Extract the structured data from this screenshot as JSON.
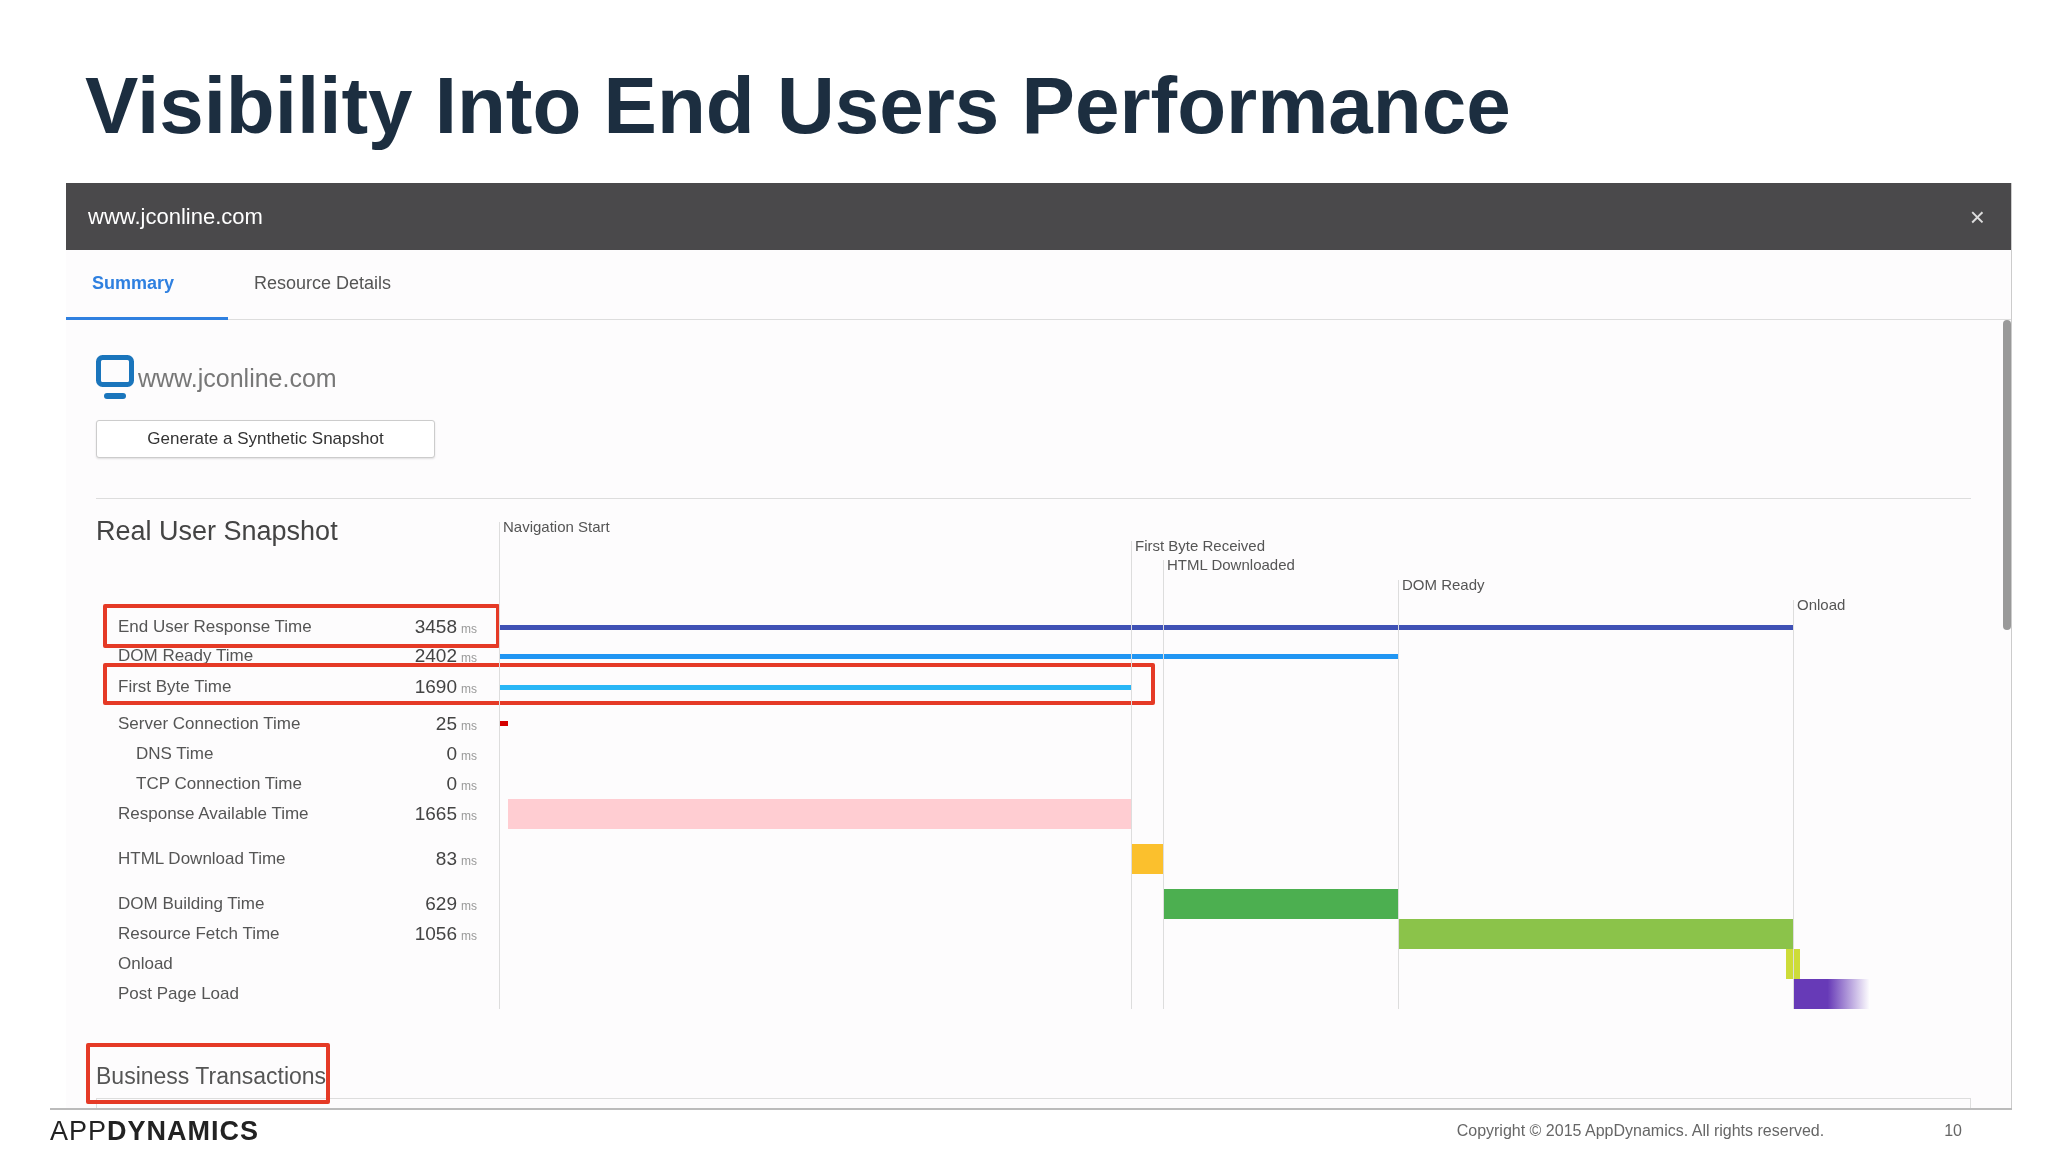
{
  "slide": {
    "title": "Visibility Into End Users Performance"
  },
  "dialog": {
    "title": "www.jconline.com",
    "close": "×",
    "tabs": [
      {
        "label": "Summary",
        "selected": true
      },
      {
        "label": "Resource Details",
        "selected": false
      }
    ],
    "page_url": "www.jconline.com",
    "button": "Generate a Synthetic Snapshot",
    "snapshot": {
      "heading": "Real User Snapshot",
      "markers": [
        {
          "label": "Navigation Start"
        },
        {
          "label": "First Byte Received"
        },
        {
          "label": "HTML Downloaded"
        },
        {
          "label": "DOM Ready"
        },
        {
          "label": "Onload"
        }
      ],
      "rows": [
        {
          "label": "End User Response Time",
          "value": "3458",
          "unit": "ms",
          "color": "#3f51b5",
          "highlighted": true
        },
        {
          "label": "DOM Ready Time",
          "value": "2402",
          "unit": "ms",
          "color": "#2196f3",
          "highlighted": false
        },
        {
          "label": "First Byte Time",
          "value": "1690",
          "unit": "ms",
          "color": "#29b6f6",
          "highlighted": true
        },
        {
          "label": "Server Connection Time",
          "value": "25",
          "unit": "ms",
          "color": "#d50000",
          "highlighted": false,
          "children": [
            {
              "label": "DNS Time",
              "value": "0",
              "unit": "ms"
            },
            {
              "label": "TCP Connection Time",
              "value": "0",
              "unit": "ms"
            }
          ]
        },
        {
          "label": "Response Available Time",
          "value": "1665",
          "unit": "ms",
          "color": "#ffcdd2",
          "highlighted": false
        },
        {
          "label": "HTML Download Time",
          "value": "83",
          "unit": "ms",
          "color": "#fbc02d",
          "highlighted": false
        },
        {
          "label": "DOM Building Time",
          "value": "629",
          "unit": "ms",
          "color": "#4caf50",
          "highlighted": false
        },
        {
          "label": "Resource Fetch Time",
          "value": "1056",
          "unit": "ms",
          "color": "#8bc34a",
          "highlighted": false
        },
        {
          "label": "Onload",
          "color": "#cddc39",
          "highlighted": false
        },
        {
          "label": "Post Page Load",
          "color": "#673ab7",
          "highlighted": false
        }
      ]
    },
    "business_transactions": {
      "heading": "Business Transactions",
      "highlighted": true
    }
  },
  "footer": {
    "logo": "APP**DYNAMICS**",
    "copyright": "Copyright © 2015 AppDynamics. All rights reserved.",
    "page_number": "10"
  }
}
